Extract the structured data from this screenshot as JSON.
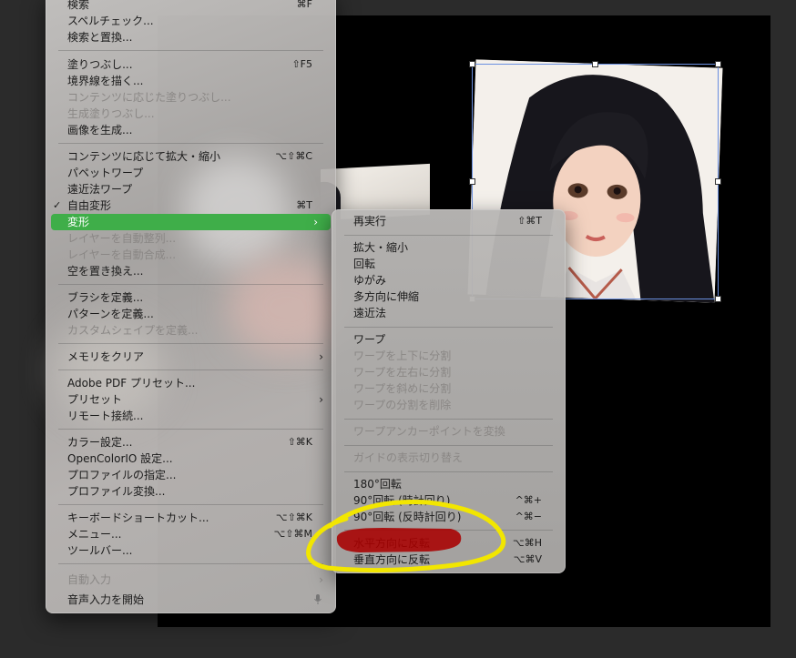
{
  "main_menu": {
    "items": [
      {
        "label": "検索",
        "shortcut": "⌘F",
        "disabled": false
      },
      {
        "label": "スペルチェック...",
        "shortcut": "",
        "disabled": false
      },
      {
        "label": "検索と置換...",
        "shortcut": "",
        "disabled": false
      },
      {
        "label": "塗りつぶし...",
        "shortcut": "⇧F5",
        "disabled": false
      },
      {
        "label": "境界線を描く...",
        "shortcut": "",
        "disabled": false
      },
      {
        "label": "コンテンツに応じた塗りつぶし...",
        "shortcut": "",
        "disabled": true
      },
      {
        "label": "生成塗りつぶし...",
        "shortcut": "",
        "disabled": true
      },
      {
        "label": "画像を生成...",
        "shortcut": "",
        "disabled": false
      },
      {
        "label": "コンテンツに応じて拡大・縮小",
        "shortcut": "⌥⇧⌘C",
        "disabled": false
      },
      {
        "label": "パペットワープ",
        "shortcut": "",
        "disabled": false
      },
      {
        "label": "遠近法ワープ",
        "shortcut": "",
        "disabled": false
      },
      {
        "label": "自由変形",
        "shortcut": "⌘T",
        "disabled": false
      },
      {
        "label": "変形",
        "shortcut": "",
        "disabled": false
      },
      {
        "label": "レイヤーを自動整列...",
        "shortcut": "",
        "disabled": true
      },
      {
        "label": "レイヤーを自動合成...",
        "shortcut": "",
        "disabled": true
      },
      {
        "label": "空を置き換え...",
        "shortcut": "",
        "disabled": false
      },
      {
        "label": "ブラシを定義...",
        "shortcut": "",
        "disabled": false
      },
      {
        "label": "パターンを定義...",
        "shortcut": "",
        "disabled": false
      },
      {
        "label": "カスタムシェイプを定義...",
        "shortcut": "",
        "disabled": true
      },
      {
        "label": "メモリをクリア",
        "shortcut": "",
        "disabled": false
      },
      {
        "label": "Adobe PDF プリセット...",
        "shortcut": "",
        "disabled": false
      },
      {
        "label": "プリセット",
        "shortcut": "",
        "disabled": false
      },
      {
        "label": "リモート接続...",
        "shortcut": "",
        "disabled": false
      },
      {
        "label": "カラー設定...",
        "shortcut": "⇧⌘K",
        "disabled": false
      },
      {
        "label": "OpenColorIO 設定...",
        "shortcut": "",
        "disabled": false
      },
      {
        "label": "プロファイルの指定...",
        "shortcut": "",
        "disabled": false
      },
      {
        "label": "プロファイル変換...",
        "shortcut": "",
        "disabled": false
      },
      {
        "label": "キーボードショートカット...",
        "shortcut": "⌥⇧⌘K",
        "disabled": false
      },
      {
        "label": "メニュー...",
        "shortcut": "⌥⇧⌘M",
        "disabled": false
      },
      {
        "label": "ツールバー...",
        "shortcut": "",
        "disabled": false
      },
      {
        "label": "自動入力",
        "shortcut": "",
        "disabled": true
      },
      {
        "label": "音声入力を開始",
        "shortcut": "",
        "disabled": false
      }
    ],
    "checked_item": "自由変形",
    "highlighted_item": "変形",
    "highlight_color": "#3fae49"
  },
  "submenu": {
    "items": [
      {
        "label": "再実行",
        "shortcut": "⇧⌘T",
        "disabled": false
      },
      {
        "label": "拡大・縮小",
        "shortcut": "",
        "disabled": false
      },
      {
        "label": "回転",
        "shortcut": "",
        "disabled": false
      },
      {
        "label": "ゆがみ",
        "shortcut": "",
        "disabled": false
      },
      {
        "label": "多方向に伸縮",
        "shortcut": "",
        "disabled": false
      },
      {
        "label": "遠近法",
        "shortcut": "",
        "disabled": false
      },
      {
        "label": "ワープ",
        "shortcut": "",
        "disabled": false
      },
      {
        "label": "ワープを上下に分割",
        "shortcut": "",
        "disabled": true
      },
      {
        "label": "ワープを左右に分割",
        "shortcut": "",
        "disabled": true
      },
      {
        "label": "ワープを斜めに分割",
        "shortcut": "",
        "disabled": true
      },
      {
        "label": "ワープの分割を削除",
        "shortcut": "",
        "disabled": true
      },
      {
        "label": "ワープアンカーポイントを変換",
        "shortcut": "",
        "disabled": true
      },
      {
        "label": "ガイドの表示切り替え",
        "shortcut": "",
        "disabled": true
      },
      {
        "label": "180°回転",
        "shortcut": "",
        "disabled": false
      },
      {
        "label": "90°回転 (時計回り)",
        "shortcut": "^⌘+",
        "disabled": false
      },
      {
        "label": "90°回転 (反時計回り)",
        "shortcut": "^⌘−",
        "disabled": false
      },
      {
        "label": "水平方向に反転",
        "shortcut": "⌥⌘H",
        "disabled": false
      },
      {
        "label": "垂直方向に反転",
        "shortcut": "⌥⌘V",
        "disabled": false
      }
    ]
  },
  "annotations": {
    "circle_color": "#f2e600",
    "marker_color": "#a80000"
  },
  "icons": {
    "submenu_arrow": "chevron-right-icon",
    "check": "checkmark-icon",
    "mic": "microphone-icon"
  }
}
